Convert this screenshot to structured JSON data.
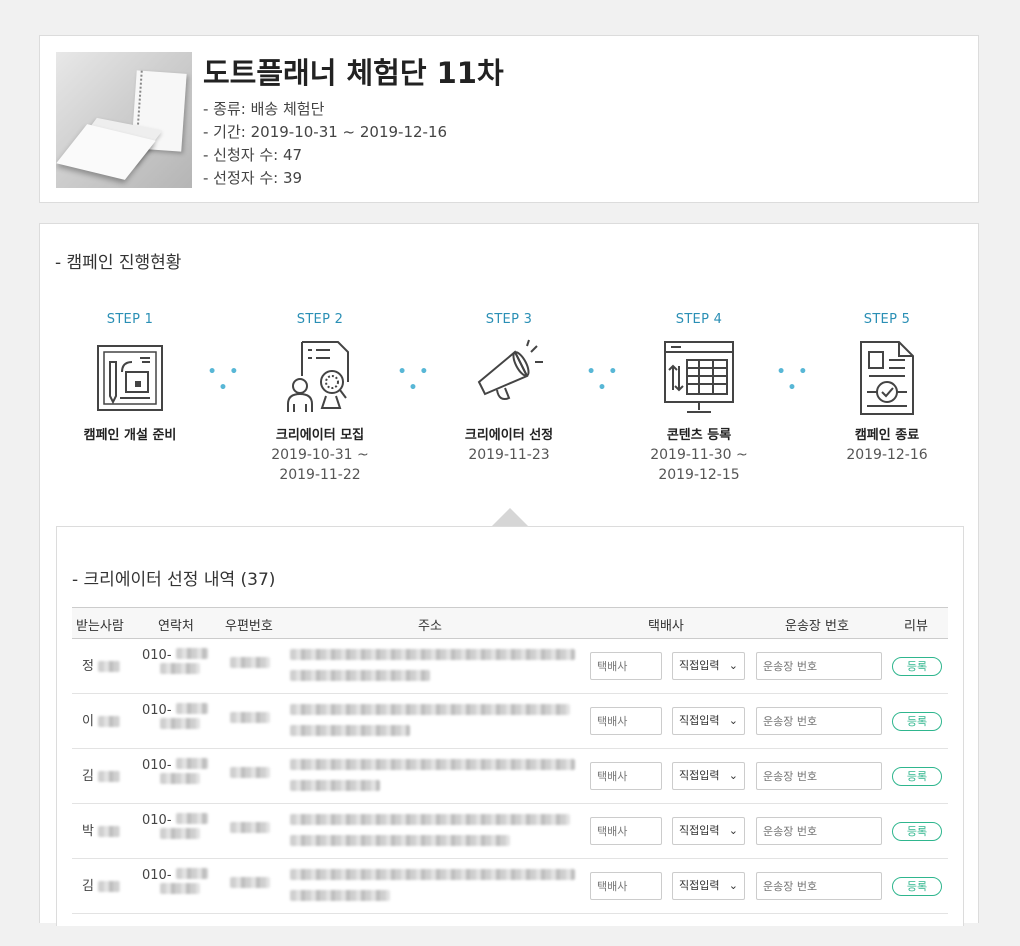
{
  "campaign": {
    "title": "도트플래너 체험단 11차",
    "info": [
      "- 종류: 배송 체험단",
      "- 기간: 2019-10-31 ~ 2019-12-16",
      "- 신청자 수: 47",
      "- 선정자 수: 39"
    ]
  },
  "progress": {
    "section_title": "- 캠페인 진행현황",
    "steps": [
      {
        "label": "STEP 1",
        "name": "캠페인 개설 준비",
        "date": "",
        "icon": "board-drawing-icon"
      },
      {
        "label": "STEP 2",
        "name": "크리에이터 모집",
        "date": "2019-10-31 ~ 2019-11-22",
        "icon": "recruit-magnifier-icon"
      },
      {
        "label": "STEP 3",
        "name": "크리에이터 선정",
        "date": "2019-11-23",
        "icon": "megaphone-icon"
      },
      {
        "label": "STEP 4",
        "name": "콘텐츠 등록",
        "date": "2019-11-30 ~ 2019-12-15",
        "icon": "content-upload-icon"
      },
      {
        "label": "STEP 5",
        "name": "캠페인 종료",
        "date": "2019-12-16",
        "icon": "document-check-icon"
      }
    ],
    "step_separator": "• • •"
  },
  "selection": {
    "title": "- 크리에이터 선정 내역 (37)",
    "columns": [
      "받는사람",
      "연락처",
      "우편번호",
      "주소",
      "택배사",
      "운송장 번호",
      "리뷰"
    ],
    "courier_placeholder": "택배사",
    "method_selected": "직접입력",
    "tracking_placeholder": "운송장 번호",
    "register_label": "등록",
    "rows": [
      {
        "name": "정",
        "phone": "010-"
      },
      {
        "name": "이",
        "phone": "010-"
      },
      {
        "name": "김",
        "phone": "010-"
      },
      {
        "name": "박",
        "phone": "010-"
      },
      {
        "name": "김",
        "phone": "010-"
      }
    ]
  },
  "colors": {
    "step_label": "#2a8fb5",
    "dots": "#58b7d6",
    "register": "#2fb68e"
  }
}
